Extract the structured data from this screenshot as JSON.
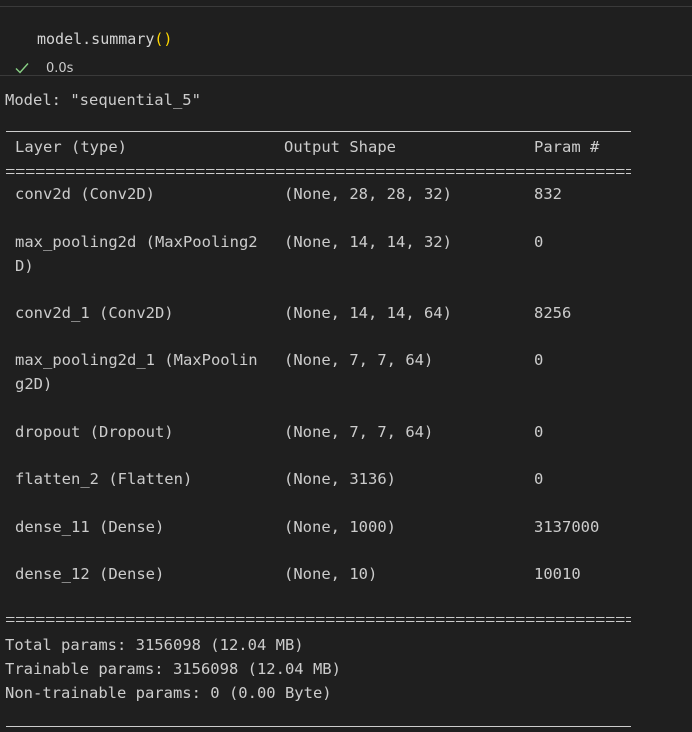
{
  "cell": {
    "code_name": "model.summary",
    "code_parens": "()",
    "exec_time": "0.0s"
  },
  "output": {
    "model_line": "Model: \"sequential_5\"",
    "headers": {
      "layer": "Layer (type)",
      "shape": "Output Shape",
      "param": "Param #"
    },
    "rows": [
      {
        "layer": "conv2d (Conv2D)",
        "layer2": "",
        "shape": "(None, 28, 28, 32)",
        "param": "832"
      },
      {
        "layer": "max_pooling2d (MaxPooling2",
        "layer2": "D)",
        "shape": "(None, 14, 14, 32)",
        "param": "0"
      },
      {
        "layer": "conv2d_1 (Conv2D)",
        "layer2": "",
        "shape": "(None, 14, 14, 64)",
        "param": "8256"
      },
      {
        "layer": "max_pooling2d_1 (MaxPoolin",
        "layer2": "g2D)",
        "shape": "(None, 7, 7, 64)",
        "param": "0"
      },
      {
        "layer": "dropout (Dropout)",
        "layer2": "",
        "shape": "(None, 7, 7, 64)",
        "param": "0"
      },
      {
        "layer": "flatten_2 (Flatten)",
        "layer2": "",
        "shape": "(None, 3136)",
        "param": "0"
      },
      {
        "layer": "dense_11 (Dense)",
        "layer2": "",
        "shape": "(None, 1000)",
        "param": "3137000"
      },
      {
        "layer": "dense_12 (Dense)",
        "layer2": "",
        "shape": "(None, 10)",
        "param": "10010"
      }
    ],
    "total": "Total params: 3156098 (12.04 MB)",
    "trainable": "Trainable params: 3156098 (12.04 MB)",
    "non_trainable": "Non-trainable params: 0 (0.00 Byte)"
  },
  "colors": {
    "background": "#1f1f1f",
    "text": "#cccccc",
    "paren": "#ffd700",
    "check": "#89d185"
  },
  "icons": {
    "status": "check-icon"
  }
}
